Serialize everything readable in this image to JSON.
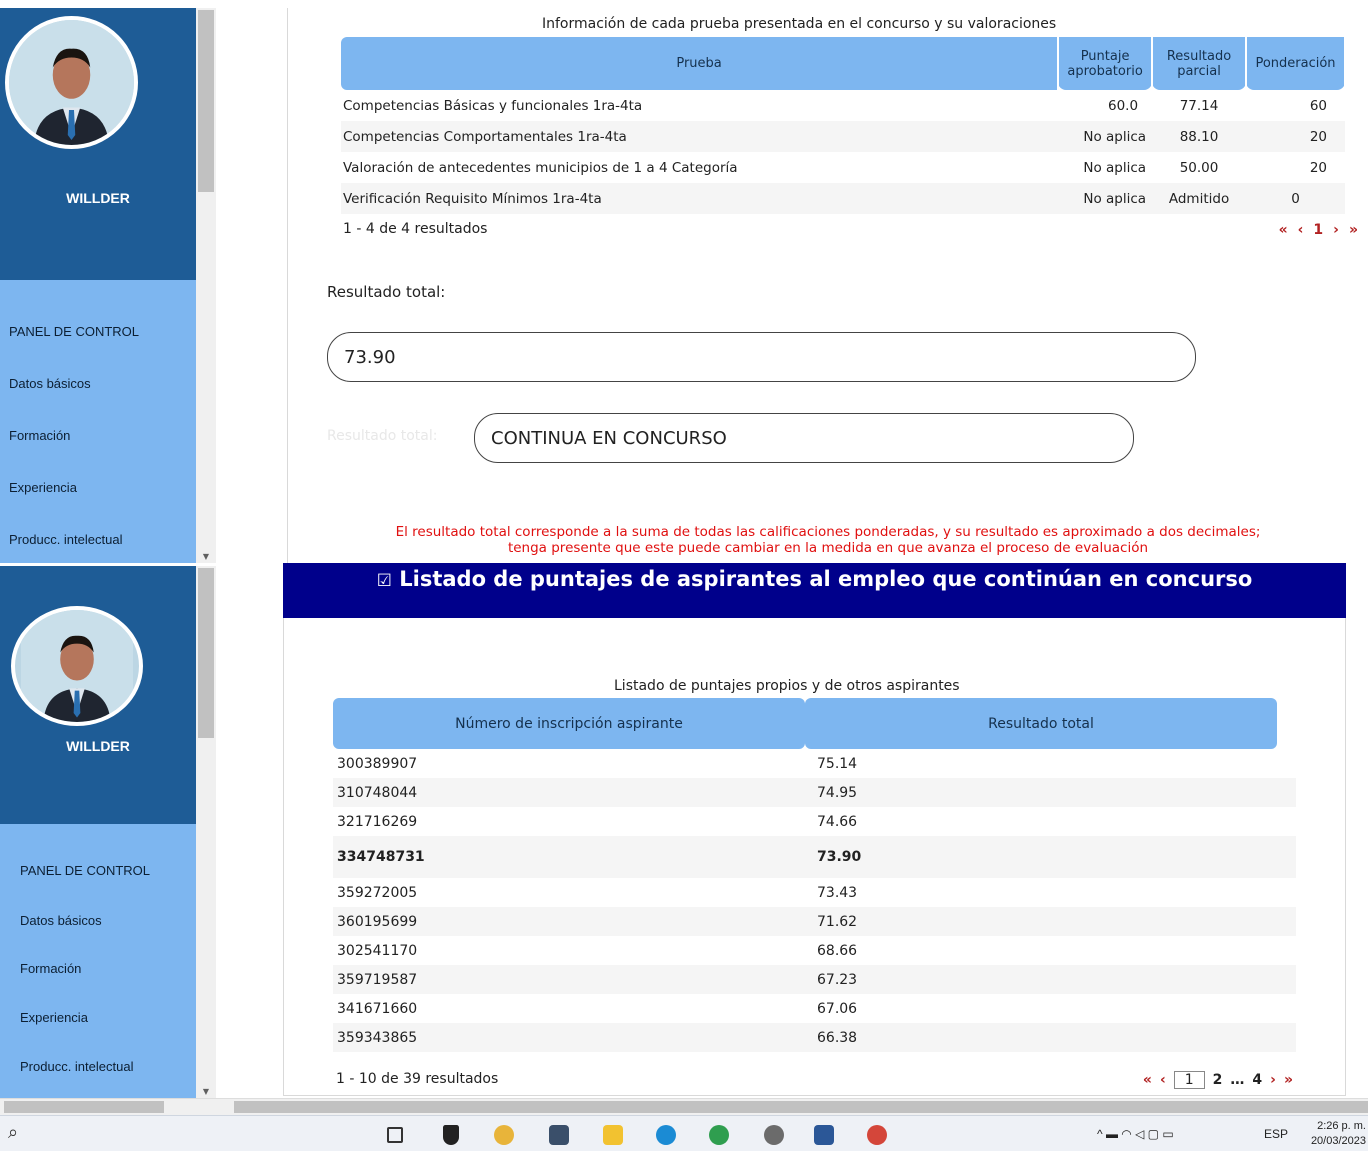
{
  "sidebar": {
    "user_name": "WILLDER",
    "menu": [
      "PANEL DE CONTROL",
      "Datos básicos",
      "Formación",
      "Experiencia",
      "Producc. intelectual"
    ]
  },
  "tests": {
    "caption": "Información de cada prueba presentada en el concurso y su valoraciones",
    "headers": [
      "Prueba",
      "Puntaje aprobatorio",
      "Resultado parcial",
      "Ponderación"
    ],
    "rows": [
      [
        "Competencias Básicas y funcionales 1ra-4ta",
        "60.0",
        "77.14",
        "60"
      ],
      [
        "Competencias Comportamentales 1ra-4ta",
        "No aplica",
        "88.10",
        "20"
      ],
      [
        "Valoración de antecedentes municipios de 1 a 4 Categoría",
        "No aplica",
        "50.00",
        "20"
      ],
      [
        "Verificación Requisito Mínimos 1ra-4ta",
        "No aplica",
        "Admitido",
        "0"
      ]
    ],
    "pager_text": "1 - 4 de 4 resultados",
    "pager": {
      "first": "«",
      "prev": "‹",
      "page": "1",
      "next": "›",
      "last": "»"
    }
  },
  "result": {
    "total_label": "Resultado total:",
    "total_value": "73.90",
    "status_label": "Resultado total:",
    "status_value": "CONTINUA EN CONCURSO",
    "note_line1": "El resultado total corresponde a la suma de todas las calificaciones ponderadas, y su resultado es aproximado a dos decimales;",
    "note_line2": "tenga presente que este puede cambiar en la medida en que avanza el proceso de evaluación"
  },
  "ranking": {
    "banner_icon": "☑",
    "banner_title": "Listado de puntajes de aspirantes al empleo que continúan en concurso",
    "caption": "Listado de puntajes propios y de otros aspirantes",
    "headers": [
      "Número de inscripción aspirante",
      "Resultado total"
    ],
    "rows": [
      [
        "300389907",
        "75.14"
      ],
      [
        "310748044",
        "74.95"
      ],
      [
        "321716269",
        "74.66"
      ],
      [
        "334748731",
        "73.90"
      ],
      [
        "359272005",
        "73.43"
      ],
      [
        "360195699",
        "71.62"
      ],
      [
        "302541170",
        "68.66"
      ],
      [
        "359719587",
        "67.23"
      ],
      [
        "341671660",
        "67.06"
      ],
      [
        "359343865",
        "66.38"
      ]
    ],
    "highlight_index": 3,
    "pager_text": "1 - 10 de 39 resultados",
    "pager": {
      "first": "«",
      "prev": "‹",
      "current": "1",
      "p2": "2",
      "dots": "…",
      "last_page": "4",
      "next": "›",
      "last": "»"
    }
  },
  "taskbar": {
    "search_icon": "⌕",
    "lang": "ESP",
    "time": "2:26 p. m.",
    "date": "20/03/2023"
  },
  "colors": {
    "sidebar_dark": "#1e5c96",
    "sidebar_light": "#7db6f0",
    "banner": "#00008b",
    "note_red": "#e01010",
    "pager_red": "#b22222"
  }
}
